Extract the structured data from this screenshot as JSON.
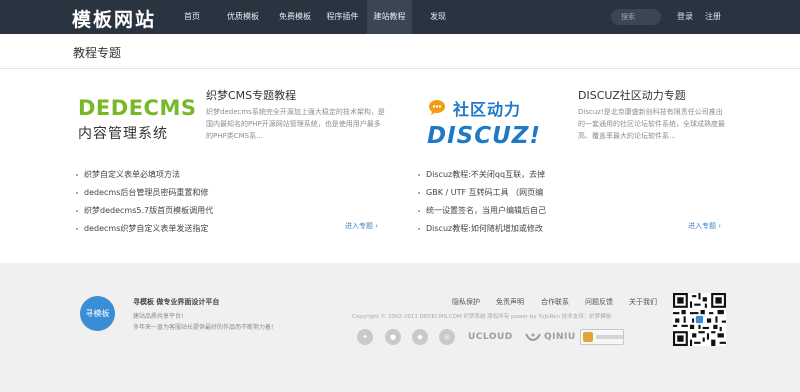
{
  "header": {
    "logo": "模板网站",
    "nav": [
      "首页",
      "优质模板",
      "免费模板",
      "程序插件",
      "建站教程",
      "发现"
    ],
    "active_nav": "建站教程",
    "search_placeholder": "搜索",
    "login": "登录",
    "register": "注册"
  },
  "page": {
    "title": "教程专题"
  },
  "topics": [
    {
      "logo_main": "DEDECMS",
      "logo_sub": "内容管理系统",
      "title": "织梦CMS专题教程",
      "desc": "织梦dedecms系统完全开源加上强大稳定的技术架构，是国内最知名的PHP开源网站管理系统，也是使用用户最多的PHP类CMS系...",
      "items": [
        "织梦自定义表单必填项方法",
        "dedecms后台管理员密码重置和修",
        "织梦dedecms5.7版首页模板调用代",
        "dedecms织梦自定义表单发送指定"
      ],
      "more": "进入专题"
    },
    {
      "logo_top": "社区动力",
      "logo_main": "DISCUZ!",
      "title": "DISCUZ社区动力专题",
      "desc": "Discuz!是北京康盛新创科技有限责任公司推出的一套通用的社区论坛软件系统，全球成熟度最高、覆盖率最大的论坛软件系...",
      "items": [
        "Discuz教程:不关闭qq互联，去掉",
        "GBK / UTF 互转码工具 （网页编",
        "统一设置签名，当用户编辑后自己",
        "Discuz教程:如何随机增加或修改"
      ],
      "more": "进入专题"
    }
  ],
  "footer": {
    "badge": "寻模板",
    "brand": "寻模板  做专业界面设计平台",
    "slogan_a": "建站品质共享平台!",
    "slogan_b": "多年来一直为客服站长提供最好的作品而不断努力着!",
    "links": [
      "隐私保护",
      "免责声明",
      "合作联系",
      "问题反馈",
      "关于我们"
    ],
    "copyright": "Copyright © 2002-2011 DEDECMS.COM 织梦系统 版权所有 power by YuJuRen 技术支持：织梦模板",
    "partners": [
      "UCLOUD",
      "QINIU"
    ]
  },
  "colors": {
    "topbar": "#2a3440",
    "accent_link": "#3b7fc4",
    "footer_bg": "#f0f0f0"
  }
}
